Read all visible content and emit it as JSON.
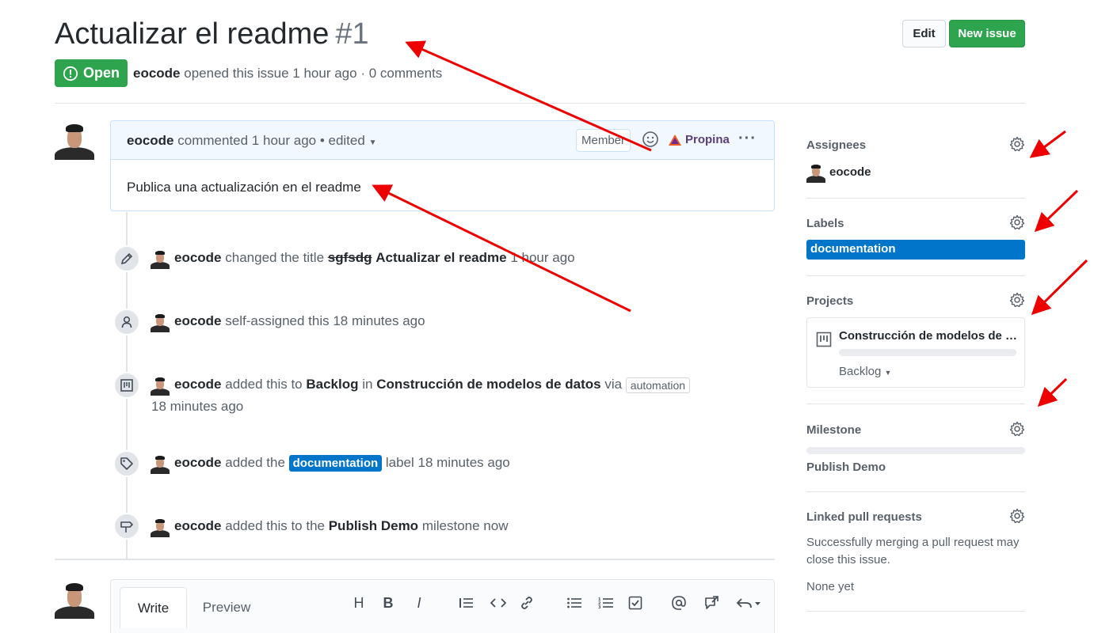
{
  "header": {
    "title": "Actualizar el readme",
    "number": "#1",
    "edit_label": "Edit",
    "new_issue_label": "New issue",
    "state": "Open",
    "author": "eocode",
    "meta_text": "opened this issue 1 hour ago · 0 comments"
  },
  "comment": {
    "author": "eocode",
    "meta": "commented 1 hour ago • edited",
    "badge": "Member",
    "propina": "Propina",
    "body": "Publica una actualización en el readme"
  },
  "timeline": {
    "title_change": {
      "author": "eocode",
      "action": "changed the title",
      "old_title": "sgfsdg",
      "new_title": "Actualizar el readme",
      "time": "1 hour ago"
    },
    "self_assign": {
      "author": "eocode",
      "text": "self-assigned this 18 minutes ago"
    },
    "project_add": {
      "author": "eocode",
      "text1": "added this to",
      "column": "Backlog",
      "in": "in",
      "project": "Construcción de modelos de datos",
      "via": "via",
      "badge": "automation",
      "time": "18 minutes ago"
    },
    "label_add": {
      "author": "eocode",
      "text1": "added the",
      "label": "documentation",
      "text2": "label 18 minutes ago"
    },
    "milestone_add": {
      "author": "eocode",
      "text1": "added this to the",
      "milestone": "Publish Demo",
      "text2": "milestone now"
    }
  },
  "composer": {
    "write_tab": "Write",
    "preview_tab": "Preview"
  },
  "sidebar": {
    "assignees": {
      "heading": "Assignees",
      "user": "eocode"
    },
    "labels": {
      "heading": "Labels",
      "label": "documentation"
    },
    "projects": {
      "heading": "Projects",
      "project": "Construcción de modelos de datos",
      "column": "Backlog"
    },
    "milestone": {
      "heading": "Milestone",
      "name": "Publish Demo"
    },
    "linked_prs": {
      "heading": "Linked pull requests",
      "description": "Successfully merging a pull request may close this issue.",
      "none": "None yet"
    }
  },
  "colors": {
    "open_green": "#2ea44f",
    "label_blue": "#0075ca",
    "annotation_red": "#ee0000"
  }
}
